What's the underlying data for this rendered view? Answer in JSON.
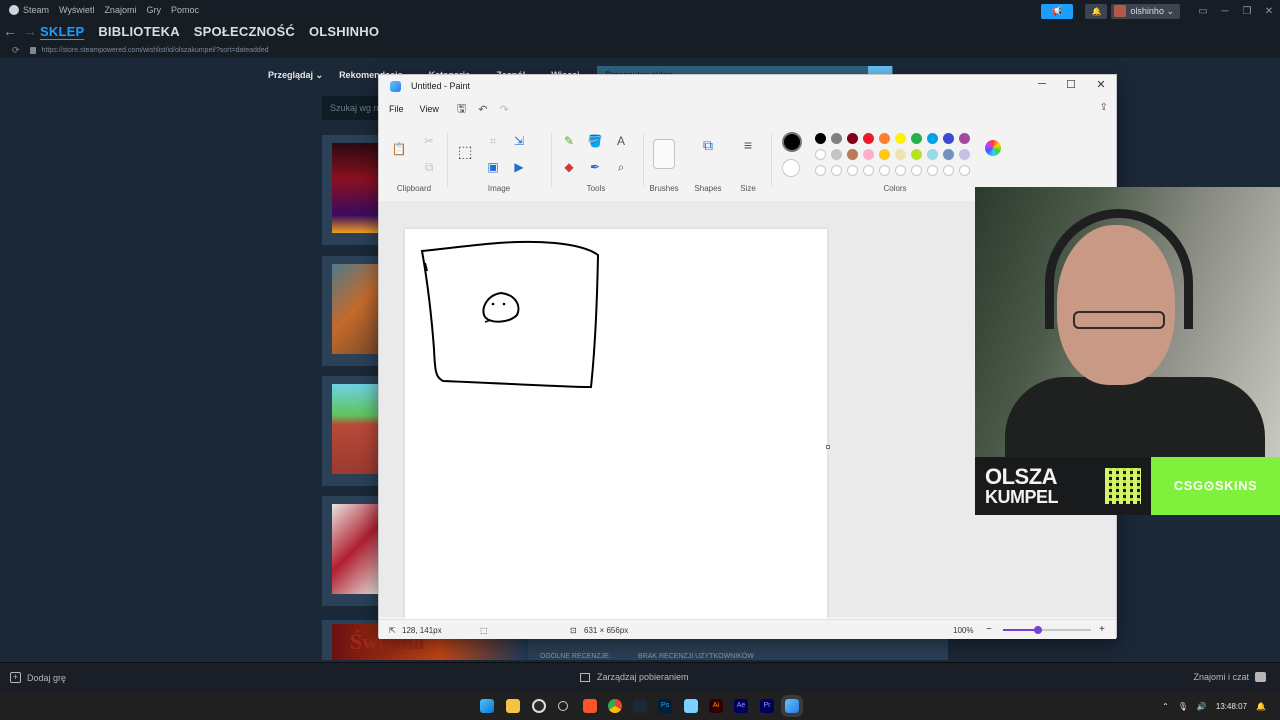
{
  "steam": {
    "menu": [
      "Steam",
      "Wyświetl",
      "Znajomi",
      "Gry",
      "Pomoc"
    ],
    "nav_back": "←",
    "nav_forward": "→",
    "tabs": [
      "SKLEP",
      "BIBLIOTEKA",
      "SPOŁECZNOŚĆ",
      "OLSHINHO"
    ],
    "url": "https://store.steampowered.com/wishlist/id/olszakumpel/?sort=dateadded",
    "username": "olshinho ⌄",
    "announce_icon": "📢",
    "bell_icon": "🔔",
    "store_nav": [
      "Przeglądaj ⌄",
      "Rekomendacje ⌄",
      "Kategorie ⌄",
      "Zespół ⌄",
      "Więcej ⌄"
    ],
    "store_search_placeholder": "Przeszukaj sklep",
    "wishlist_search_placeholder": "Szukaj wg n",
    "bottom_card_game": "Świetna",
    "bottom_card_review_label": "OGÓLNE RECENZJE:",
    "bottom_card_review_value": "BRAK RECENZJI UŻYTKOWNIKÓW",
    "bottom_left": "Dodaj grę",
    "bottom_center": "Zarządzaj pobieraniem",
    "bottom_right": "Znajomi i czat"
  },
  "paint": {
    "title": "Untitled - Paint",
    "menu": {
      "file": "File",
      "view": "View"
    },
    "groups": {
      "clipboard": "Clipboard",
      "image": "Image",
      "tools": "Tools",
      "brushes": "Brushes",
      "shapes": "Shapes",
      "size": "Size",
      "colors": "Colors"
    },
    "status": {
      "cursor_pos": "128, 141px",
      "canvas_size": "631 × 656px",
      "zoom": "100%",
      "zoom_value": 0.4
    },
    "primary_color": "#000000",
    "secondary_color": "#ffffff",
    "palette_row1": [
      "#000000",
      "#7f7f7f",
      "#880015",
      "#ed1c24",
      "#ff7f27",
      "#fff200",
      "#22b14c",
      "#00a2e8",
      "#3f48cc",
      "#a349a4"
    ],
    "palette_row2": [
      "#ffffff",
      "#c3c3c3",
      "#b97a57",
      "#ffaec9",
      "#ffc90e",
      "#efe4b0",
      "#b5e61d",
      "#99d9ea",
      "#7092be",
      "#c8bfe7"
    ],
    "palette_row3_count": 10
  },
  "webcam": {
    "brand_top": "OLSZA",
    "brand_bottom": "KUMPEL",
    "sponsor": "CSG⊙SKINS"
  },
  "taskbar": {
    "apps": [
      "windows-start",
      "file-explorer",
      "obs",
      "wallet",
      "brave",
      "chrome",
      "steam",
      "photoshop",
      "notepad",
      "illustrator",
      "after-effects",
      "premiere",
      "paint"
    ],
    "time": "13:48:07",
    "up_arrow": "⌃",
    "mic": "🎙",
    "volume": "🔊"
  }
}
